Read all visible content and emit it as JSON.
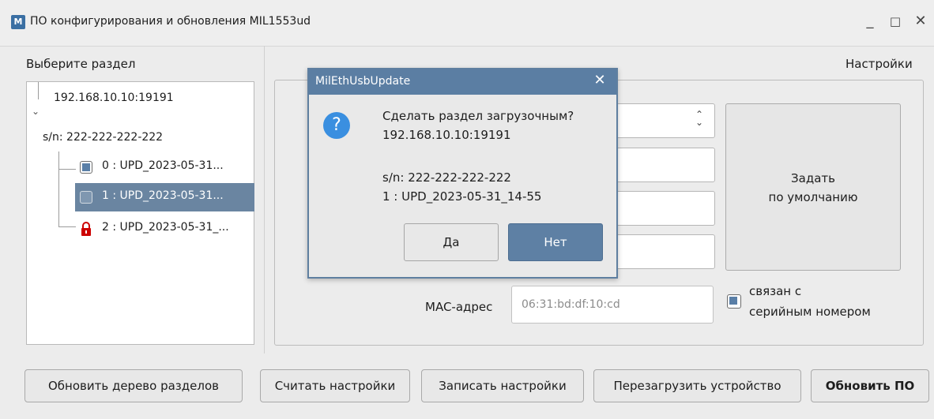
{
  "window": {
    "title": "ПО конфигурирования и обновления MIL1553ud",
    "controls": [
      "_",
      "□",
      "✕"
    ]
  },
  "left_panel": {
    "label": "Выберите раздел",
    "tree": {
      "host": "192.168.10.10:19191",
      "serial": "s/n: 222-222-222-222",
      "partitions": [
        {
          "label": "0 : UPD_2023-05-31...",
          "checked": true,
          "locked": false
        },
        {
          "label": "1 : UPD_2023-05-31...",
          "checked": false,
          "locked": false,
          "selected": true
        },
        {
          "label": "2 : UPD_2023-05-31_...",
          "checked": false,
          "locked": true
        }
      ]
    }
  },
  "settings": {
    "label": "Настройки",
    "default_button": {
      "line1": "Задать",
      "line2": "по умолчанию"
    },
    "mac_label": "MAC-адрес",
    "mac_value": "06:31:bd:df:10:cd",
    "linked_checkbox": {
      "line1": "связан с",
      "line2": "серийным номером",
      "checked": true
    }
  },
  "buttons": {
    "refresh_tree": "Обновить дерево разделов",
    "read_settings": "Считать настройки",
    "write_settings": "Записать настройки",
    "reboot_device": "Перезагрузить устройство",
    "update_fw": "Обновить ПО"
  },
  "dialog": {
    "title": "MilEthUsbUpdate",
    "question": "Сделать раздел загрузочным?",
    "host": "192.168.10.10:19191",
    "serial": "s/n: 222-222-222-222",
    "partition": "1 : UPD_2023-05-31_14-55",
    "yes": "Да",
    "no": "Нет",
    "icon": "question-icon"
  },
  "colors": {
    "accent": "#5b7ea3",
    "selection": "#6a85a1",
    "question_icon": "#3a8fe0",
    "lock": "#cc0000"
  }
}
